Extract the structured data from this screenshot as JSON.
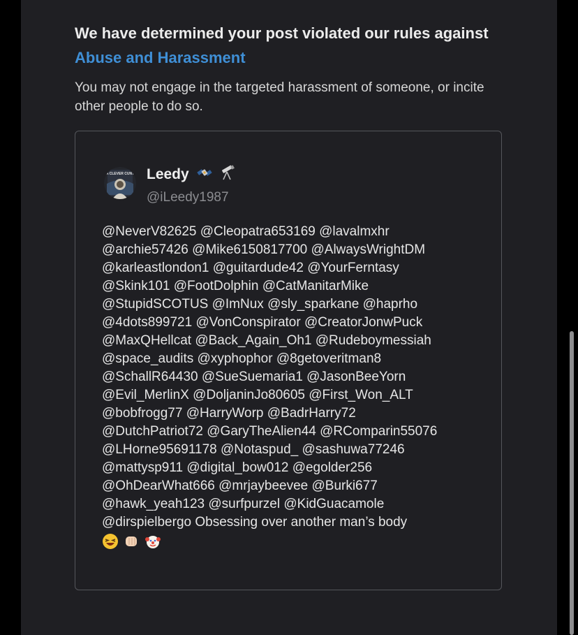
{
  "notice": {
    "headline_prefix": "We have determined your post violated our rules against",
    "rule_link": "Abuse and Harassment",
    "subtext": "You may not engage in the targeted harassment of someone, or incite other people to do so."
  },
  "post": {
    "avatar_text": "A CLEVER CUNT",
    "display_name": "Leedy",
    "name_badges": [
      "satellite-icon",
      "telescope-icon"
    ],
    "handle": "@iLeedy1987",
    "body_lines": [
      "@NeverV82625 @Cleopatra653169 @lavalmxhr",
      "@archie57426 @Mike6150817700 @AlwaysWrightDM",
      "@karleastlondon1 @guitardude42 @YourFerntasy",
      "@Skink101 @FootDolphin @CatManitarMike",
      "@StupidSCOTUS @ImNux @sly_sparkane @haprho",
      "@4dots899721 @VonConspirator @CreatorJonwPuck",
      "@MaxQHellcat @Back_Again_Oh1 @Rudeboymessiah",
      "@space_audits @xyphophor @8getoveritman8",
      "@SchallR64430 @SueSuemaria1 @JasonBeeYorn",
      "@Evil_MerlinX @DoljaninJo80605 @First_Won_ALT",
      "@bobfrogg77 @HarryWorp @BadrHarry72",
      "@DutchPatriot72 @GaryTheAlien44 @RComparin55076",
      "@LHorne95691178 @Notaspud_ @sashuwa77246",
      "@mattysp911 @digital_bow012 @egolder256",
      "@OhDearWhat666 @mrjaybeevee @Burki677",
      "@hawk_yeah123 @surfpurzel @KidGuacamole",
      "@dirspielbergo Obsessing over another man’s body"
    ],
    "body_emojis": [
      "laughing-face-icon",
      "fist-bump-icon",
      "clown-face-icon"
    ]
  },
  "colors": {
    "background": "#000000",
    "panel": "#1f1f23",
    "link": "#3f8fd6",
    "card_border": "#55565b",
    "handle": "#8b8c90"
  }
}
